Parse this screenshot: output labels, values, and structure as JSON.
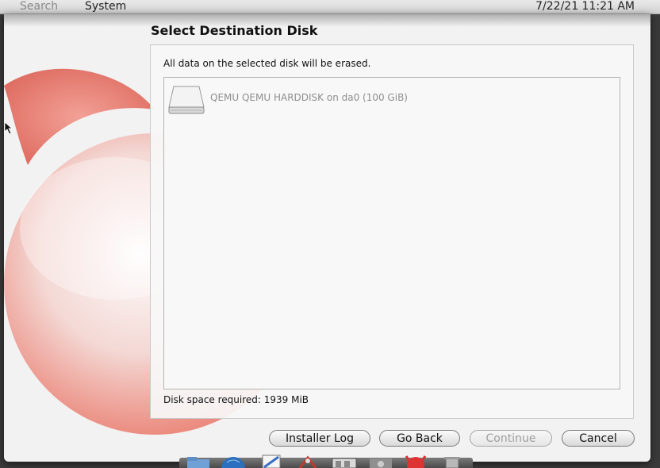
{
  "menubar": {
    "search_label": "Search",
    "system_label": "System",
    "clock": "7/22/21 11:21 AM"
  },
  "window": {
    "title": "Select Destination Disk",
    "erase_note": "All data on the selected disk will be erased.",
    "disks": [
      {
        "label": "QEMU QEMU HARDDISK on da0 (100 GiB)",
        "icon": "hard-disk-icon"
      }
    ],
    "space_required": "Disk space required: 1939 MiB"
  },
  "buttons": {
    "installer_log": "Installer Log",
    "go_back": "Go Back",
    "continue": "Continue",
    "cancel": "Cancel"
  },
  "dock_icons": [
    "folder-icon",
    "globe-icon",
    "notepad-icon",
    "scissors-icon",
    "window-icon",
    "gear-icon",
    "bsd-daemon-icon",
    "trash-icon"
  ],
  "colors": {
    "wallpaper_accent": "#e96a5a",
    "window_bg": "#f2f2f2"
  }
}
